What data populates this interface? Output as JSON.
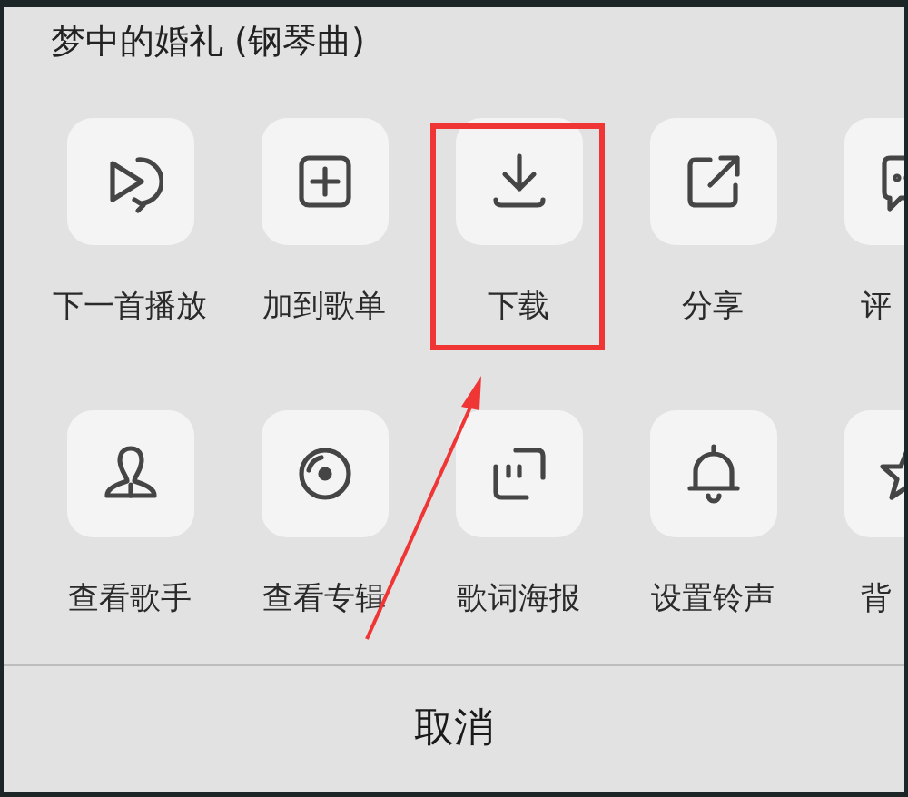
{
  "title": "梦中的婚礼 (钢琴曲)",
  "rows": [
    {
      "items": [
        {
          "label": "下一首播放",
          "highlighted": false
        },
        {
          "label": "加到歌单",
          "highlighted": false
        },
        {
          "label": "下载",
          "highlighted": true
        },
        {
          "label": "分享",
          "highlighted": false
        },
        {
          "label": "评",
          "highlighted": false
        }
      ]
    },
    {
      "items": [
        {
          "label": "查看歌手",
          "highlighted": false
        },
        {
          "label": "查看专辑",
          "highlighted": false
        },
        {
          "label": "歌词海报",
          "highlighted": false
        },
        {
          "label": "设置铃声",
          "highlighted": false
        },
        {
          "label": "背",
          "highlighted": false
        }
      ]
    }
  ],
  "cancel_button": "取消"
}
